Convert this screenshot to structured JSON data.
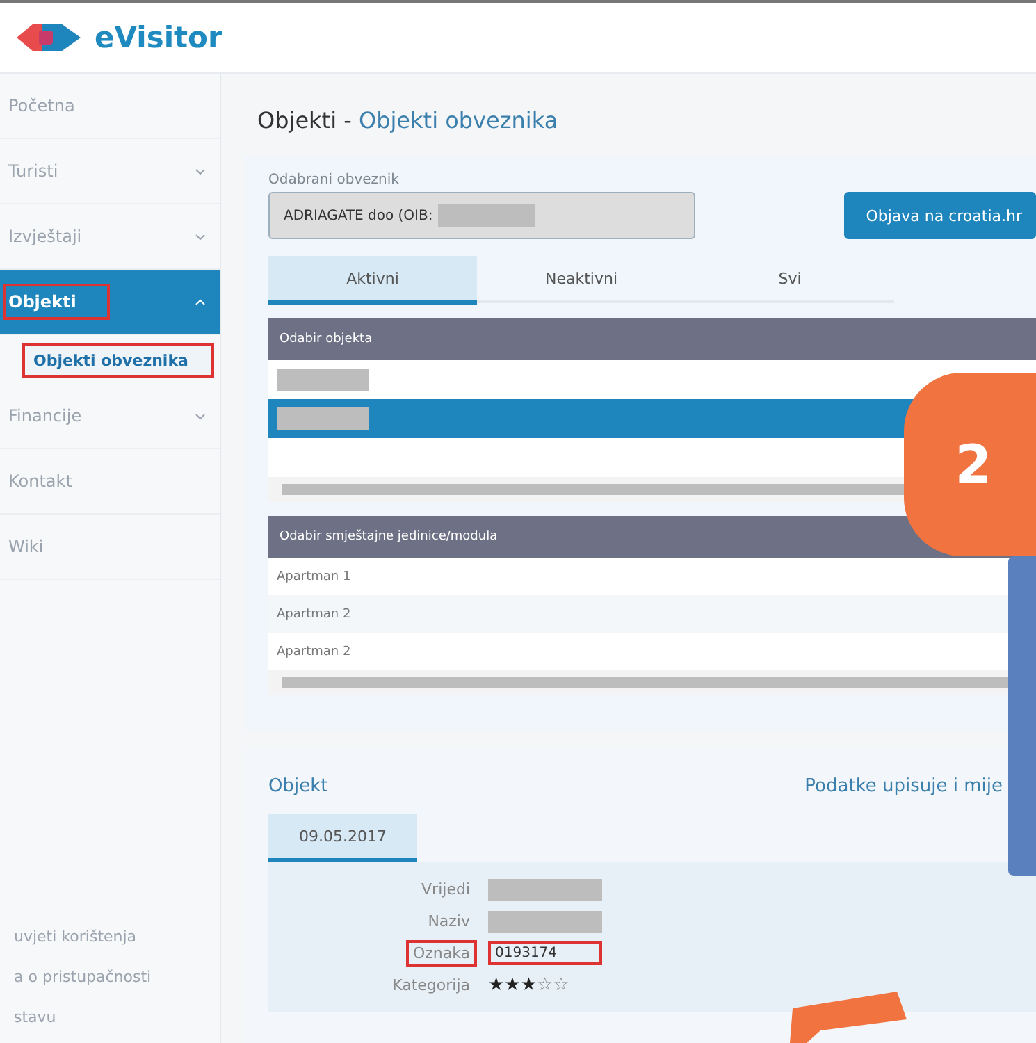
{
  "header": {
    "logo_text": "eVisitor"
  },
  "sidebar": {
    "items": [
      {
        "label": "Početna",
        "expandable": false,
        "selected": false,
        "highlighted": false
      },
      {
        "label": "Turisti",
        "expandable": true,
        "expanded": false,
        "selected": false,
        "highlighted": false
      },
      {
        "label": "Izvještaji",
        "expandable": true,
        "expanded": false,
        "selected": false,
        "highlighted": false
      },
      {
        "label": "Objekti",
        "expandable": true,
        "expanded": true,
        "selected": true,
        "highlighted": true,
        "children": [
          {
            "label": "Objekti obveznika",
            "selected": true,
            "highlighted": true
          }
        ]
      },
      {
        "label": "Financije",
        "expandable": true,
        "expanded": false,
        "selected": false,
        "highlighted": false
      },
      {
        "label": "Kontakt",
        "expandable": false,
        "selected": false,
        "highlighted": false
      },
      {
        "label": "Wiki",
        "expandable": false,
        "selected": false,
        "highlighted": false
      }
    ],
    "footer_links": [
      "uvjeti korištenja",
      "a o pristupačnosti",
      "stavu"
    ]
  },
  "page_title": {
    "section": "Objekti",
    "separator": " - ",
    "page": "Objekti obveznika"
  },
  "selection_card": {
    "taxpayer_label": "Odabrani obveznik",
    "taxpayer_value": "ADRIAGATE doo (OIB:",
    "publish_button": "Objava na croatia.hr",
    "tabs": [
      {
        "label": "Aktivni",
        "selected": true
      },
      {
        "label": "Neaktivni",
        "selected": false
      },
      {
        "label": "Svi",
        "selected": false
      }
    ],
    "objects_table": {
      "header": "Odabir objekta",
      "rows": [
        {
          "kind": "redacted",
          "selected": false
        },
        {
          "kind": "redacted",
          "selected": true
        },
        {
          "kind": "empty",
          "selected": false
        }
      ]
    },
    "units_table": {
      "header": "Odabir smještajne jedinice/modula",
      "rows": [
        {
          "label": "Apartman 1",
          "selected": false
        },
        {
          "label": "Apartman 2",
          "selected": false
        },
        {
          "label": "Apartman 2",
          "selected": false
        }
      ]
    }
  },
  "object_card": {
    "title": "Objekt",
    "note": "Podatke upisuje i mije",
    "tabs": [
      {
        "label": "09.05.2017",
        "selected": true
      }
    ],
    "fields": [
      {
        "label": "Vrijedi",
        "kind": "redacted",
        "highlighted": false
      },
      {
        "label": "Naziv",
        "kind": "redacted",
        "highlighted": false
      },
      {
        "label": "Oznaka",
        "kind": "text",
        "value": "0193174",
        "highlighted": true
      },
      {
        "label": "Kategorija",
        "kind": "stars",
        "stars": 3,
        "highlighted": false
      }
    ]
  },
  "annotation": {
    "step_badge": "2"
  }
}
